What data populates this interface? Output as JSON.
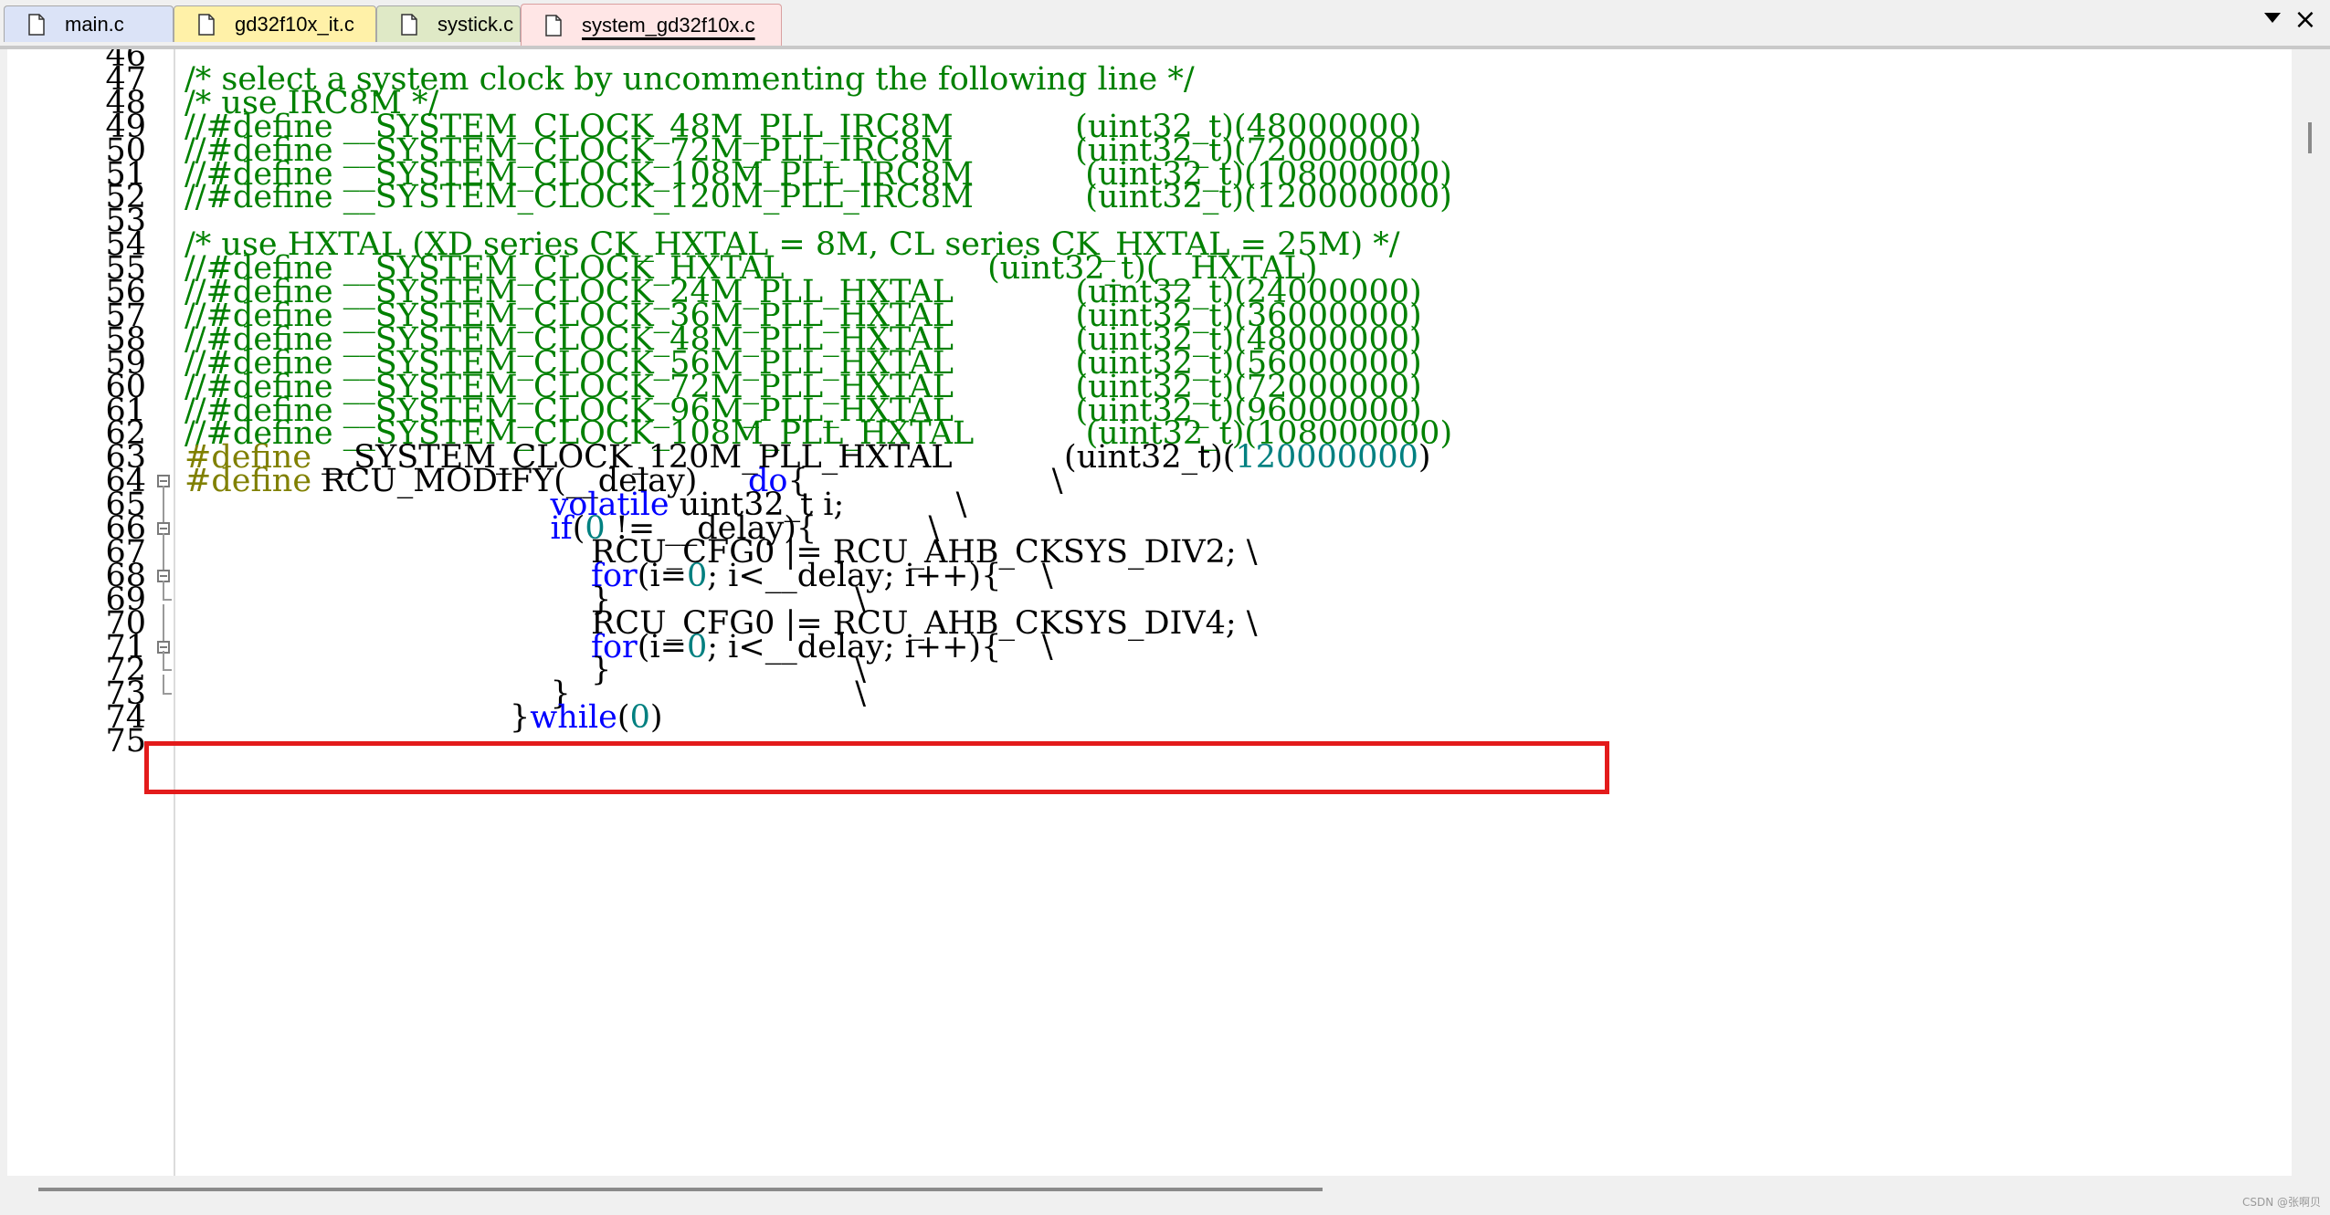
{
  "tabs": [
    {
      "label": "main.c",
      "color": "#dbe3f7"
    },
    {
      "label": "gd32f10x_it.c",
      "color": "#fff1a8"
    },
    {
      "label": "systick.c",
      "color": "#dfe9c6"
    },
    {
      "label": "system_gd32f10x.c",
      "color": "#ffe6e6",
      "active": true
    }
  ],
  "tab_controls": {
    "menu_icon": "chevron-down-icon",
    "close_icon": "close-icon",
    "close_glyph": "×"
  },
  "syntax_colors": {
    "comment": "#008000",
    "preprocessor": "#808000",
    "keyword": "#0000ff",
    "number": "#008080",
    "text": "#000000"
  },
  "highlight_color": "#e31b1b",
  "editor": {
    "lines": [
      {
        "n": "46",
        "fold": "",
        "tokens": []
      },
      {
        "n": "47",
        "fold": "",
        "tokens": [
          {
            "t": "cm",
            "s": "/* select a system clock by uncommenting the following line */"
          }
        ]
      },
      {
        "n": "48",
        "fold": "",
        "tokens": [
          {
            "t": "cm",
            "s": "/* use IRC8M */"
          }
        ]
      },
      {
        "n": "49",
        "fold": "",
        "tokens": [
          {
            "t": "cm",
            "s": "//#define __SYSTEM_CLOCK_48M_PLL_IRC8M            (uint32_t)(48000000)"
          }
        ]
      },
      {
        "n": "50",
        "fold": "",
        "tokens": [
          {
            "t": "cm",
            "s": "//#define __SYSTEM_CLOCK_72M_PLL_IRC8M            (uint32_t)(72000000)"
          }
        ]
      },
      {
        "n": "51",
        "fold": "",
        "tokens": [
          {
            "t": "cm",
            "s": "//#define __SYSTEM_CLOCK_108M_PLL_IRC8M           (uint32_t)(108000000)"
          }
        ]
      },
      {
        "n": "52",
        "fold": "",
        "tokens": [
          {
            "t": "cm",
            "s": "//#define __SYSTEM_CLOCK_120M_PLL_IRC8M           (uint32_t)(120000000)"
          }
        ]
      },
      {
        "n": "53",
        "fold": "",
        "tokens": []
      },
      {
        "n": "54",
        "fold": "",
        "tokens": [
          {
            "t": "cm",
            "s": "/* use HXTAL (XD series CK_HXTAL = 8M, CL series CK_HXTAL = 25M) */"
          }
        ]
      },
      {
        "n": "55",
        "fold": "",
        "tokens": [
          {
            "t": "cm",
            "s": "//#define __SYSTEM_CLOCK_HXTAL                    (uint32_t)(__HXTAL)"
          }
        ]
      },
      {
        "n": "56",
        "fold": "",
        "tokens": [
          {
            "t": "cm",
            "s": "//#define __SYSTEM_CLOCK_24M_PLL_HXTAL            (uint32_t)(24000000)"
          }
        ]
      },
      {
        "n": "57",
        "fold": "",
        "tokens": [
          {
            "t": "cm",
            "s": "//#define __SYSTEM_CLOCK_36M_PLL_HXTAL            (uint32_t)(36000000)"
          }
        ]
      },
      {
        "n": "58",
        "fold": "",
        "tokens": [
          {
            "t": "cm",
            "s": "//#define __SYSTEM_CLOCK_48M_PLL_HXTAL            (uint32_t)(48000000)"
          }
        ]
      },
      {
        "n": "59",
        "fold": "",
        "tokens": [
          {
            "t": "cm",
            "s": "//#define __SYSTEM_CLOCK_56M_PLL_HXTAL            (uint32_t)(56000000)"
          }
        ]
      },
      {
        "n": "60",
        "fold": "",
        "tokens": [
          {
            "t": "cm",
            "s": "//#define __SYSTEM_CLOCK_72M_PLL_HXTAL            (uint32_t)(72000000)"
          }
        ]
      },
      {
        "n": "61",
        "fold": "",
        "tokens": [
          {
            "t": "cm",
            "s": "//#define __SYSTEM_CLOCK_96M_PLL_HXTAL            (uint32_t)(96000000)"
          }
        ]
      },
      {
        "n": "62",
        "fold": "",
        "tokens": [
          {
            "t": "cm",
            "s": "//#define __SYSTEM_CLOCK_108M_PLL_HXTAL           (uint32_t)(108000000)"
          }
        ]
      },
      {
        "n": "63",
        "fold": "",
        "tokens": [
          {
            "t": "pp",
            "s": "#define"
          },
          {
            "t": "tx",
            "s": " __SYSTEM_CLOCK_120M_PLL_HXTAL           (uint32_t)("
          },
          {
            "t": "nu",
            "s": "120000000"
          },
          {
            "t": "tx",
            "s": ")"
          }
        ]
      },
      {
        "n": "64",
        "fold": "open",
        "tokens": [
          {
            "t": "pp",
            "s": "#define"
          },
          {
            "t": "tx",
            "s": " RCU_MODIFY(__delay)     "
          },
          {
            "t": "kw",
            "s": "do"
          },
          {
            "t": "tx",
            "s": "{                        \\"
          }
        ]
      },
      {
        "n": "65",
        "fold": "line",
        "tokens": [
          {
            "t": "tx",
            "s": "                                    "
          },
          {
            "t": "kw",
            "s": "volatile"
          },
          {
            "t": "tx",
            "s": " uint32_t i;           \\"
          }
        ]
      },
      {
        "n": "66",
        "fold": "open",
        "tokens": [
          {
            "t": "tx",
            "s": "                                    "
          },
          {
            "t": "kw",
            "s": "if"
          },
          {
            "t": "tx",
            "s": "("
          },
          {
            "t": "nu",
            "s": "0"
          },
          {
            "t": "tx",
            "s": " != __delay){           \\"
          }
        ]
      },
      {
        "n": "67",
        "fold": "line",
        "tokens": [
          {
            "t": "tx",
            "s": "                                        RCU_CFG0 |= RCU_AHB_CKSYS_DIV2; \\"
          }
        ]
      },
      {
        "n": "68",
        "fold": "open",
        "tokens": [
          {
            "t": "tx",
            "s": "                                        "
          },
          {
            "t": "kw",
            "s": "for"
          },
          {
            "t": "tx",
            "s": "(i="
          },
          {
            "t": "nu",
            "s": "0"
          },
          {
            "t": "tx",
            "s": "; i<__delay; i++){    \\"
          }
        ]
      },
      {
        "n": "69",
        "fold": "end",
        "tokens": [
          {
            "t": "tx",
            "s": "                                        }                        \\"
          }
        ]
      },
      {
        "n": "70",
        "fold": "line",
        "tokens": [
          {
            "t": "tx",
            "s": "                                        RCU_CFG0 |= RCU_AHB_CKSYS_DIV4; \\"
          }
        ]
      },
      {
        "n": "71",
        "fold": "open",
        "tokens": [
          {
            "t": "tx",
            "s": "                                        "
          },
          {
            "t": "kw",
            "s": "for"
          },
          {
            "t": "tx",
            "s": "(i="
          },
          {
            "t": "nu",
            "s": "0"
          },
          {
            "t": "tx",
            "s": "; i<__delay; i++){    \\"
          }
        ]
      },
      {
        "n": "72",
        "fold": "end",
        "tokens": [
          {
            "t": "tx",
            "s": "                                        }                        \\"
          }
        ]
      },
      {
        "n": "73",
        "fold": "end",
        "tokens": [
          {
            "t": "tx",
            "s": "                                    }                            \\"
          }
        ]
      },
      {
        "n": "74",
        "fold": "",
        "tokens": [
          {
            "t": "tx",
            "s": "                                }"
          },
          {
            "t": "kw",
            "s": "while"
          },
          {
            "t": "tx",
            "s": "("
          },
          {
            "t": "nu",
            "s": "0"
          },
          {
            "t": "tx",
            "s": ")"
          }
        ]
      },
      {
        "n": "75",
        "fold": "",
        "tokens": []
      }
    ]
  },
  "watermark": "CSDN @张啊贝"
}
